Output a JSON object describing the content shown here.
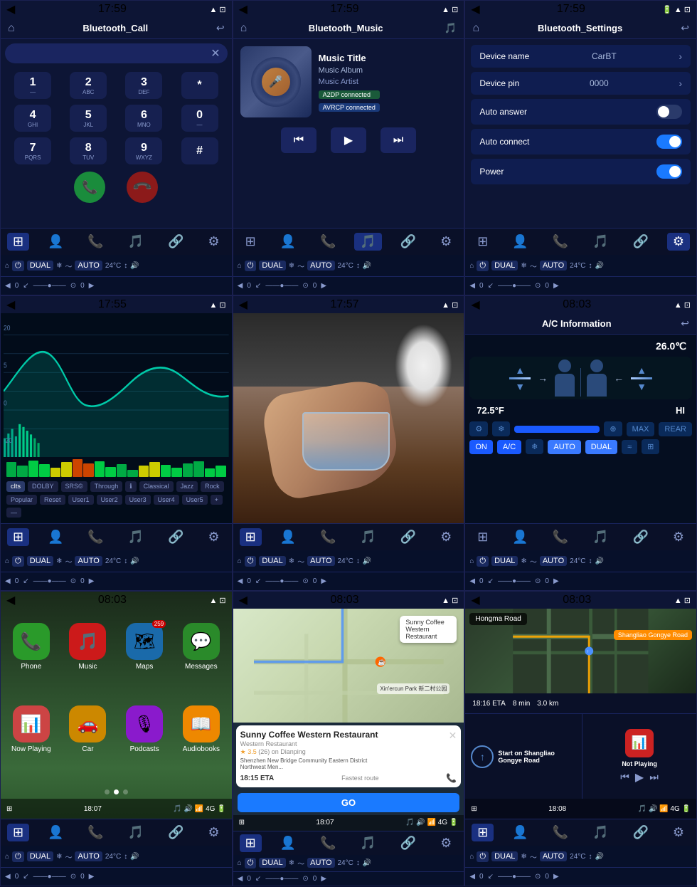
{
  "panels": [
    {
      "id": "bluetooth-call",
      "statusBar": {
        "time": "17:59",
        "icons": "▲ ⊡"
      },
      "titleBar": {
        "title": "Bluetooth_Call"
      },
      "dialpad": {
        "rows": [
          [
            {
              "num": "1",
              "alpha": "—"
            },
            {
              "num": "2",
              "alpha": "ABC"
            },
            {
              "num": "3",
              "alpha": "DEF"
            },
            {
              "num": "*",
              "alpha": ""
            }
          ],
          [
            {
              "num": "4",
              "alpha": "GHI"
            },
            {
              "num": "5",
              "alpha": "JKL"
            },
            {
              "num": "6",
              "alpha": "MNO"
            },
            {
              "num": "0",
              "alpha": "—"
            }
          ],
          [
            {
              "num": "7",
              "alpha": "PQRS"
            },
            {
              "num": "8",
              "alpha": "TUV"
            },
            {
              "num": "9",
              "alpha": "WXYZ"
            },
            {
              "num": "#",
              "alpha": ""
            }
          ]
        ],
        "callBtn": "📞",
        "hangupBtn": "📞"
      }
    },
    {
      "id": "bluetooth-music",
      "statusBar": {
        "time": "17:59",
        "icons": "▲ ⊡"
      },
      "titleBar": {
        "title": "Bluetooth_Music"
      },
      "music": {
        "title": "Music Title",
        "album": "Music Album",
        "artist": "Music Artist",
        "a2dp": "A2DP connected",
        "avrcp": "AVRCP connected"
      },
      "activeTab": "music"
    },
    {
      "id": "bluetooth-settings",
      "statusBar": {
        "time": "17:59",
        "icons": "🔋 ▲ ⊡"
      },
      "titleBar": {
        "title": "Bluetooth_Settings"
      },
      "settings": [
        {
          "label": "Device name",
          "value": "CarBT",
          "hasChevron": true,
          "hasToggle": false
        },
        {
          "label": "Device pin",
          "value": "0000",
          "hasChevron": true,
          "hasToggle": false
        },
        {
          "label": "Auto answer",
          "value": "",
          "hasChevron": false,
          "hasToggle": true,
          "toggleOn": false
        },
        {
          "label": "Auto connect",
          "value": "",
          "hasChevron": false,
          "hasToggle": true,
          "toggleOn": true
        },
        {
          "label": "Power",
          "value": "",
          "hasChevron": false,
          "hasToggle": true,
          "toggleOn": true
        }
      ],
      "activeTab": "settings"
    },
    {
      "id": "equalizer",
      "statusBar": {
        "time": "17:55",
        "icons": "▲ ⊡"
      },
      "eq": {
        "presets": [
          "cIts",
          "",
          "DOLBY",
          "SRS©",
          "Through",
          "",
          "Classical",
          "Jazz",
          "Rock",
          "Popular",
          "Reset",
          "ℹ",
          "User1",
          "User2",
          "User3",
          "User4",
          "User5",
          "+",
          "—"
        ]
      }
    },
    {
      "id": "video",
      "statusBar": {
        "time": "17:57",
        "icons": "▲ ⊡"
      }
    },
    {
      "id": "ac-info",
      "statusBar": {
        "time": "08:03",
        "icons": "▲ ⊡"
      },
      "titleBar": {
        "title": "A/C Information"
      },
      "ac": {
        "tempC": "26.0℃",
        "tempF": "72.5°F",
        "level": "HI",
        "buttons": [
          "ON",
          "A/C",
          "❄",
          "AUTO",
          "DUAL",
          "≈",
          "⊞"
        ]
      }
    },
    {
      "id": "carplay-home",
      "statusBar": {
        "time": "08:03",
        "icons": "▲ ⊡"
      },
      "apps": [
        {
          "label": "Phone",
          "icon": "📞",
          "bg": "app-phone"
        },
        {
          "label": "Music",
          "icon": "🎵",
          "bg": "app-music"
        },
        {
          "label": "Maps",
          "icon": "🗺",
          "bg": "app-maps",
          "badge": "259"
        },
        {
          "label": "Messages",
          "icon": "💬",
          "bg": "app-messages"
        },
        {
          "label": "Now Playing",
          "icon": "📊",
          "bg": "app-nowplaying"
        },
        {
          "label": "Car",
          "icon": "🚗",
          "bg": "app-car"
        },
        {
          "label": "Podcasts",
          "icon": "🎙",
          "bg": "app-podcasts"
        },
        {
          "label": "Audiobooks",
          "icon": "📖",
          "bg": "app-audiobooks"
        }
      ],
      "bottomTime": "18:07"
    },
    {
      "id": "navigation-poi",
      "statusBar": {
        "time": "08:03",
        "icons": "▲ ⊡"
      },
      "poi": {
        "name": "Sunny Coffee Western Restaurant",
        "type": "Western Restaurant",
        "rating": "3.5",
        "ratingCount": "(26) on Dianping",
        "address": "Shenzhen New Bridge Community Eastern District Northwest Men...",
        "eta": "18:15 ETA",
        "etaNote": "Fastest route",
        "goLabel": "GO"
      },
      "bottomTime": "18:07"
    },
    {
      "id": "navigation-map",
      "statusBar": {
        "time": "08:03",
        "icons": "▲ ⊡"
      },
      "map": {
        "streetTop": "Hongma Road",
        "streetDest": "Shangliao Gongye Road",
        "eta": "18:16 ETA",
        "duration": "8 min",
        "distance": "3.0 km"
      },
      "nowPlaying": {
        "title": "Start on Shangliao Gongye Road",
        "status": "Not Playing"
      },
      "bottomTime": "18:08"
    }
  ],
  "navTabs": {
    "icons": [
      "⊞",
      "👤",
      "📞",
      "🎵",
      "🔗",
      "⚙"
    ],
    "settingsIcon": "⚙"
  },
  "ctrlBar": {
    "home": "🏠",
    "power": "⏻",
    "dual": "DUAL",
    "snowflake": "❄",
    "wave": "〜",
    "auto": "AUTO",
    "arrows": "↕",
    "vol": "🔊"
  }
}
